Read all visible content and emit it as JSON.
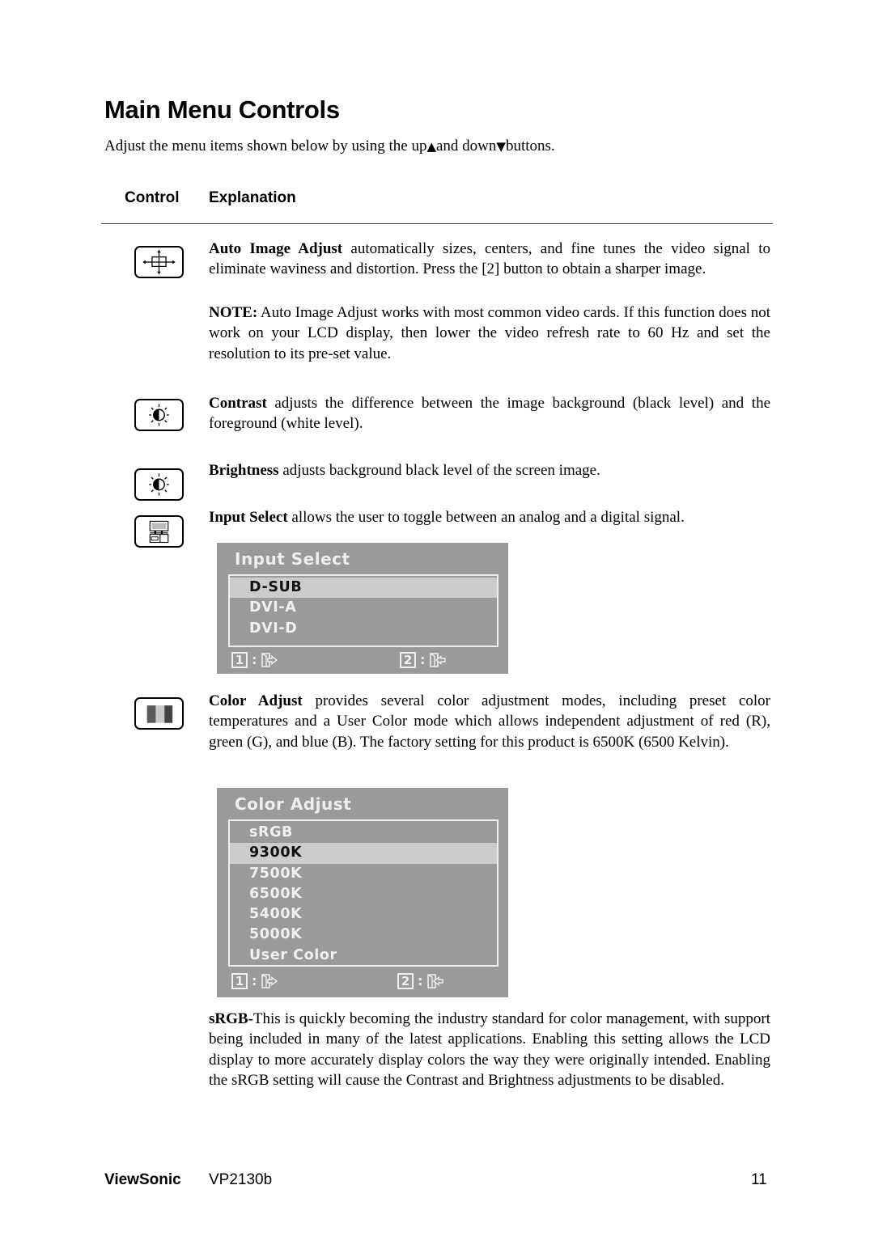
{
  "page": {
    "title": "Main Menu Controls",
    "intro": {
      "before_up": "Adjust the menu items shown below by using the up",
      "up_glyph": "▲",
      "between": "and down",
      "down_glyph": "▼",
      "after": "buttons."
    },
    "table_header": {
      "control": "Control",
      "explanation": "Explanation"
    }
  },
  "controls": [
    {
      "icon": "auto-image-adjust-icon",
      "name": "Auto Image Adjust",
      "text": " automatically sizes, centers, and fine tunes the video signal to eliminate waviness and distortion. Press the [2] button to obtain a sharper image.",
      "note_label": "NOTE:",
      "note_text": " Auto Image Adjust works with most common video cards. If this function does not work on your LCD display, then lower the video refresh rate to 60 Hz and set the resolution to its pre-set value."
    },
    {
      "icon": "contrast-icon",
      "name": "Contrast",
      "text": " adjusts the difference between the image background  (black level) and the foreground (white level)."
    },
    {
      "icon": "brightness-icon",
      "name": "Brightness",
      "text": " adjusts background black level of the screen image."
    },
    {
      "icon": "input-select-icon",
      "name": "Input Select",
      "text": " allows the user to toggle between an analog and a digital signal."
    },
    {
      "icon": "color-adjust-icon",
      "name": "Color Adjust",
      "text": " provides several color adjustment modes, including preset color temperatures and a User Color mode which allows independent adjustment of red (R), green (G), and blue (B). The factory setting for this product is 6500K (6500 Kelvin)."
    }
  ],
  "osd_input_select": {
    "title": "Input Select",
    "items": [
      "D-SUB",
      "DVI-A",
      "DVI-D"
    ],
    "selected": "D-SUB",
    "key1": "1",
    "key2": "2",
    "colon": ":"
  },
  "osd_color_adjust": {
    "title": "Color Adjust",
    "items": [
      "sRGB",
      "9300K",
      "7500K",
      "6500K",
      "5400K",
      "5000K",
      "User Color"
    ],
    "selected": "9300K",
    "key1": "1",
    "key2": "2",
    "colon": ":"
  },
  "srgb_note": {
    "label": "sRGB-",
    "text": "This is quickly becoming the industry standard for color management, with support being included in many of the latest applications. Enabling this setting allows the LCD display to more accurately display colors the way they were originally intended. Enabling the sRGB setting will cause the Contrast and Brightness adjustments to be disabled."
  },
  "footer": {
    "brand": "ViewSonic",
    "model": "VP2130b",
    "page_number": "11"
  },
  "colors": {
    "osd_background": "#9a9a9a",
    "osd_selected": "#cccccc",
    "osd_text": "#f0f0f0"
  }
}
